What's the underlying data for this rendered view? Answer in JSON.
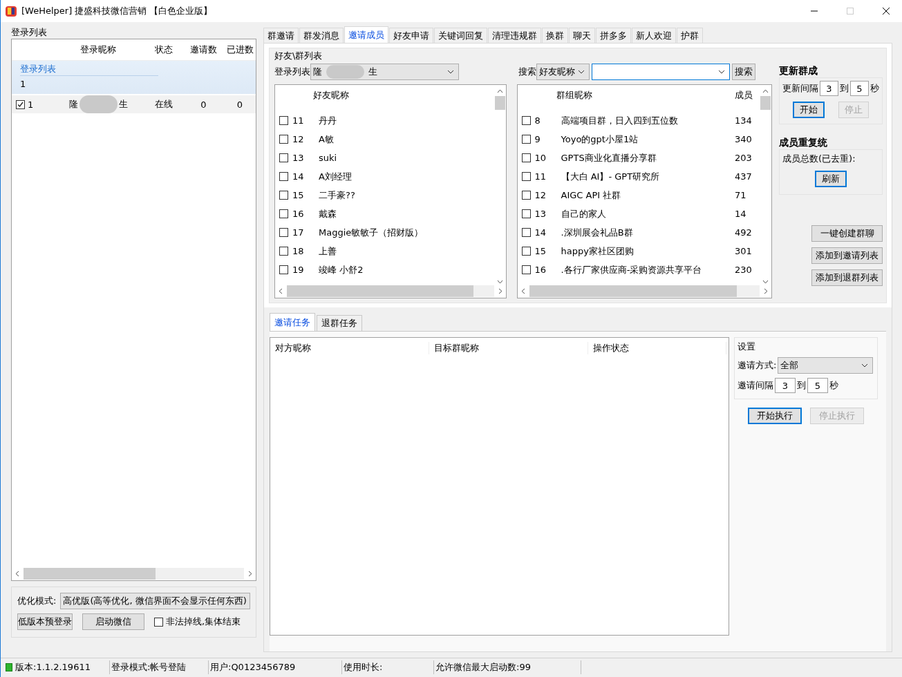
{
  "window": {
    "title": "[WeHelper] 捷盛科技微信营销 【白色企业版】"
  },
  "login_panel": {
    "title": "登录列表",
    "columns": [
      "登录昵称",
      "状态",
      "邀请数",
      "已进数"
    ],
    "group": {
      "label": "登录列表",
      "count": "1"
    },
    "rows": [
      {
        "checked": true,
        "index": "1",
        "name_parts": [
          "隆",
          "生"
        ],
        "status": "在线",
        "invites": "0",
        "joined": "0"
      }
    ],
    "optimize": {
      "label": "优化模式:",
      "value": "高优版(高等优化, 微信界面不会显示任何东西)"
    },
    "buttons": [
      {
        "label": "低版本预登录",
        "disabled": false
      },
      {
        "label": "启动微信",
        "disabled": false
      }
    ],
    "option": {
      "label": "非法掉线,集体结束",
      "checked": false
    }
  },
  "tabs": [
    {
      "label": "群邀请",
      "selected": false
    },
    {
      "label": "群发消息",
      "selected": false
    },
    {
      "label": "邀请成员",
      "selected": true
    },
    {
      "label": "好友申请",
      "selected": false
    },
    {
      "label": "关键词回复",
      "selected": false
    },
    {
      "label": "清理违规群",
      "selected": false
    },
    {
      "label": "换群",
      "selected": false
    },
    {
      "label": "聊天",
      "selected": false
    },
    {
      "label": "拼多多",
      "selected": false
    },
    {
      "label": "新人欢迎",
      "selected": false
    },
    {
      "label": "护群",
      "selected": false
    }
  ],
  "friend_group": {
    "title": "好友\\群列表",
    "account_label": "登录列表",
    "account_parts": [
      "隆",
      "生"
    ],
    "friend_list": {
      "column": "好友昵称",
      "rows": [
        {
          "checked": false,
          "index": "11",
          "name": "丹丹"
        },
        {
          "checked": false,
          "index": "12",
          "name": "A敏"
        },
        {
          "checked": false,
          "index": "13",
          "name": "suki"
        },
        {
          "checked": false,
          "index": "14",
          "name": "A刘经理"
        },
        {
          "checked": false,
          "index": "15",
          "name": "二手豪??"
        },
        {
          "checked": false,
          "index": "16",
          "name": "戴森"
        },
        {
          "checked": false,
          "index": "17",
          "name": "Maggie敏敏子（招财版）"
        },
        {
          "checked": false,
          "index": "18",
          "name": "上善"
        },
        {
          "checked": false,
          "index": "19",
          "name": "竣峰 小舒2"
        }
      ]
    },
    "search": {
      "label": "搜索",
      "field_type": "好友昵称",
      "button": "搜索"
    },
    "group_list": {
      "columns": [
        "群组昵称",
        "成员"
      ],
      "rows": [
        {
          "checked": false,
          "index": "8",
          "name": "高端项目群，日入四到五位数",
          "members": "134"
        },
        {
          "checked": false,
          "index": "9",
          "name": "Yoyo的gpt小屋1站",
          "members": "340"
        },
        {
          "checked": false,
          "index": "10",
          "name": "GPTS商业化直播分享群",
          "members": "203"
        },
        {
          "checked": false,
          "index": "11",
          "name": "【大白 AI】- GPT研究所",
          "members": "437"
        },
        {
          "checked": false,
          "index": "12",
          "name": "AIGC API 社群",
          "members": "71"
        },
        {
          "checked": false,
          "index": "13",
          "name": "自己的家人",
          "members": "14"
        },
        {
          "checked": false,
          "index": "14",
          "name": ".深圳展会礼品B群",
          "members": "492"
        },
        {
          "checked": false,
          "index": "15",
          "name": "happy家社区团购",
          "members": "301"
        },
        {
          "checked": false,
          "index": "16",
          "name": ".各行厂家供应商-采购资源共享平台",
          "members": "230"
        }
      ]
    }
  },
  "update_panel": {
    "title": "更新群成",
    "interval_label": "更新间隔",
    "from": "3",
    "to_label": "到",
    "to": "5",
    "unit": "秒",
    "buttons": [
      {
        "label": "开始",
        "disabled": false,
        "default": true
      },
      {
        "label": "停止",
        "disabled": true,
        "default": false
      }
    ]
  },
  "dedupe_panel": {
    "title": "成员重复统",
    "total_label": "成员总数(已去重):",
    "buttons": [
      {
        "label": "刷新",
        "disabled": false,
        "default": true
      }
    ]
  },
  "actions": [
    {
      "label": "一键创建群聊",
      "disabled": false
    },
    {
      "label": "添加到邀请列表",
      "disabled": false
    },
    {
      "label": "添加到退群列表",
      "disabled": false
    }
  ],
  "task_tabs": [
    {
      "label": "邀请任务",
      "selected": true
    },
    {
      "label": "退群任务",
      "selected": false
    }
  ],
  "task_table": {
    "columns": [
      "对方昵称",
      "目标群昵称",
      "操作状态"
    ]
  },
  "settings": {
    "title": "设置",
    "method_label": "邀请方式:",
    "method": "全部",
    "interval_label": "邀请间隔",
    "from": "3",
    "to_label": "到",
    "to": "5",
    "unit": "秒",
    "buttons": [
      {
        "label": "开始执行",
        "disabled": false,
        "default": true
      },
      {
        "label": "停止执行",
        "disabled": true,
        "default": false
      }
    ]
  },
  "status_bar": [
    {
      "text": "版本:1.1.2.19611"
    },
    {
      "text": "登录模式:帐号登陆"
    },
    {
      "text": "用户:Q0123456789"
    },
    {
      "text": "使用时长:"
    },
    {
      "text": "允许微信最大启动数:99"
    }
  ]
}
